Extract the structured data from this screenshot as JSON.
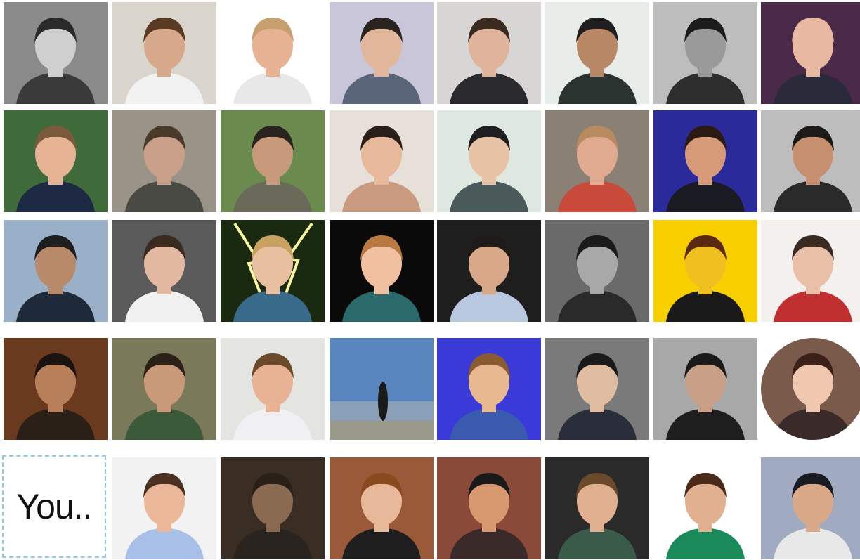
{
  "grid": {
    "you_label": "You..",
    "avatars": [
      {
        "name": "avatar-row1-col1",
        "bg": "#8a8a8a",
        "shirt": "#3a3a3a",
        "skin": "#cfcfcf",
        "hair": "#2a2a2a",
        "gray": true
      },
      {
        "name": "avatar-row1-col2",
        "bg": "#d9d4cc",
        "shirt": "#f2f2f2",
        "skin": "#d6a98a",
        "hair": "#5a3a22"
      },
      {
        "name": "avatar-row1-col3",
        "bg": "#ffffff",
        "shirt": "#e8e8e8",
        "skin": "#e7b193",
        "hair": "#c8a070"
      },
      {
        "name": "avatar-row1-col4",
        "bg": "#c8c6d8",
        "shirt": "#5a6478",
        "skin": "#e2b69a",
        "hair": "#2a2420"
      },
      {
        "name": "avatar-row1-col5",
        "bg": "#d8d6d4",
        "shirt": "#2a2a2e",
        "skin": "#e0b49a",
        "hair": "#3a2a20"
      },
      {
        "name": "avatar-row1-col6",
        "bg": "#e8ece8",
        "shirt": "#2b3330",
        "skin": "#b88866",
        "hair": "#1e1e1e"
      },
      {
        "name": "avatar-row1-col7",
        "bg": "#bdbdbd",
        "shirt": "#2e2e2e",
        "skin": "#9a9a9a",
        "hair": "#1c1c1c",
        "gray": true
      },
      {
        "name": "avatar-row1-col8",
        "bg": "#4a2a48",
        "shirt": "#2a2a3a",
        "skin": "#e8b8a0",
        "hair": "#e8b8a0"
      },
      {
        "name": "avatar-row2-col1",
        "bg": "#3f6b3a",
        "shirt": "#1e2a44",
        "skin": "#e6b394",
        "hair": "#7a5a3a"
      },
      {
        "name": "avatar-row2-col2",
        "bg": "#9a9488",
        "shirt": "#4a4a44",
        "skin": "#caa08a",
        "hair": "#4a3a2a"
      },
      {
        "name": "avatar-row2-col3",
        "bg": "#6a8a4e",
        "shirt": "#6a6a5a",
        "skin": "#c69a7a",
        "hair": "#2a2420"
      },
      {
        "name": "avatar-row2-col4",
        "bg": "#e6e0d8",
        "shirt": "#c89a80",
        "skin": "#e7b89a",
        "hair": "#2a1e18"
      },
      {
        "name": "avatar-row2-col5",
        "bg": "#dfe8e0",
        "shirt": "#4a5a5a",
        "skin": "#e8c2a4",
        "hair": "#1e1e22"
      },
      {
        "name": "avatar-row2-col6",
        "bg": "#8a8074",
        "shirt": "#c84a3a",
        "skin": "#e0aa90",
        "hair": "#b88a60"
      },
      {
        "name": "avatar-row2-col7",
        "bg": "#2a2a9a",
        "shirt": "#1a1a22",
        "skin": "#d69a78",
        "hair": "#2a1a12"
      },
      {
        "name": "avatar-row2-col8",
        "bg": "#bdbdbd",
        "shirt": "#2a2a2a",
        "skin": "#c69070",
        "hair": "#1e1a18"
      },
      {
        "name": "avatar-row3-col1",
        "bg": "#9ab0c8",
        "shirt": "#1e2a3a",
        "skin": "#b88a6a",
        "hair": "#1e1e1e"
      },
      {
        "name": "avatar-row3-col2",
        "bg": "#5a5a5a",
        "shirt": "#f0f0f0",
        "skin": "#e2b8a0",
        "hair": "#3a2a20"
      },
      {
        "name": "avatar-row3-col3",
        "bg": "#1a2a10",
        "shirt": "#3a6a8a",
        "skin": "#e8c0a0",
        "hair": "#c8a060",
        "bolt": true
      },
      {
        "name": "avatar-row3-col4",
        "bg": "#0a0a0a",
        "shirt": "#2a6a6a",
        "skin": "#f0c0a0",
        "hair": "#b87a40"
      },
      {
        "name": "avatar-row3-col5",
        "bg": "#1e1e1e",
        "shirt": "#b8c8e0",
        "skin": "#d8a888",
        "hair": "#1e1a18"
      },
      {
        "name": "avatar-row3-col6",
        "bg": "#6a6a6a",
        "shirt": "#2a2a2a",
        "skin": "#a8a8a8",
        "hair": "#1a1a1a",
        "gray": true
      },
      {
        "name": "avatar-row3-col7",
        "bg": "#f8d000",
        "shirt": "#1a1a1a",
        "skin": "#f0c020",
        "hair": "#5a2a10"
      },
      {
        "name": "avatar-row3-col8",
        "bg": "#f4f0ee",
        "shirt": "#c03030",
        "skin": "#e8c0a8",
        "hair": "#3a2a22"
      },
      {
        "name": "avatar-row4-col1",
        "bg": "#6a3a1e",
        "shirt": "#2a2018",
        "skin": "#b8805a",
        "hair": "#1a1410"
      },
      {
        "name": "avatar-row4-col2",
        "bg": "#7a7a5a",
        "shirt": "#3a5a3a",
        "skin": "#c89a7a",
        "hair": "#2a2018"
      },
      {
        "name": "avatar-row4-col3",
        "bg": "#e4e4e0",
        "shirt": "#f0f0f4",
        "skin": "#e8b294",
        "hair": "#6a4a2a"
      },
      {
        "name": "avatar-row4-col4",
        "bg": "#5a86c0",
        "shirt": "#1a1a1a",
        "skin": "#1a1a1a",
        "hair": "#1a1a1a",
        "tiny": true
      },
      {
        "name": "avatar-row4-col5",
        "bg": "#3a3ad8",
        "shirt": "#3a5ab0",
        "skin": "#e8b890",
        "hair": "#8a5a30"
      },
      {
        "name": "avatar-row4-col6",
        "bg": "#7a7a7a",
        "shirt": "#2a2e3a",
        "skin": "#e0bca0",
        "hair": "#1a1a1a"
      },
      {
        "name": "avatar-row4-col7",
        "bg": "#a8a8a8",
        "shirt": "#1e1e1e",
        "skin": "#c8a088",
        "hair": "#1a1a1a"
      },
      {
        "name": "avatar-row4-col8",
        "bg": "#7a5a4a",
        "shirt": "#3a2a2a",
        "skin": "#f0c8b0",
        "hair": "#3a2018",
        "round": true
      },
      {
        "name": "avatar-row5-col2",
        "bg": "#f2f2f2",
        "shirt": "#a8c0e8",
        "skin": "#eab898",
        "hair": "#4a3020"
      },
      {
        "name": "avatar-row5-col3",
        "bg": "#3a2e24",
        "shirt": "#2a2420",
        "skin": "#8a6a50",
        "hair": "#2a2018"
      },
      {
        "name": "avatar-row5-col4",
        "bg": "#9a5a3a",
        "shirt": "#1e1e1e",
        "skin": "#e8b89a",
        "hair": "#8a4a20"
      },
      {
        "name": "avatar-row5-col5",
        "bg": "#8a4a3a",
        "shirt": "#3a2a2a",
        "skin": "#d89870",
        "hair": "#1a1a1a"
      },
      {
        "name": "avatar-row5-col6",
        "bg": "#2a2a2a",
        "shirt": "#3a5a4a",
        "skin": "#e0b090",
        "hair": "#6a4a2a"
      },
      {
        "name": "avatar-row5-col7",
        "bg": "#ffffff",
        "shirt": "#1a8a5a",
        "skin": "#e0b090",
        "hair": "#4a2a18"
      },
      {
        "name": "avatar-row5-col8",
        "bg": "#a0aac0",
        "shirt": "#e8e8e8",
        "skin": "#d8a888",
        "hair": "#1a1a22"
      }
    ]
  }
}
